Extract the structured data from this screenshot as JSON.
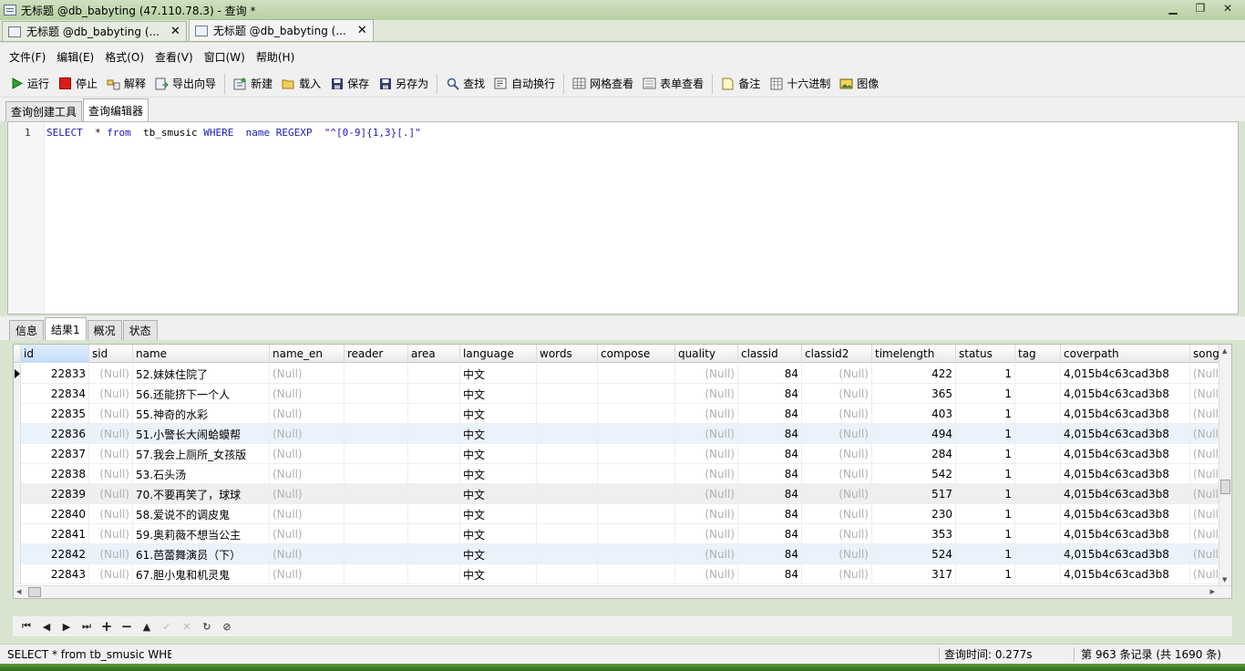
{
  "window": {
    "title": "无标题 @db_babyting (47.110.78.3) - 查询 *"
  },
  "doc_tabs": [
    {
      "label": "无标题 @db_babyting (..."
    },
    {
      "label": "无标题 @db_babyting (..."
    }
  ],
  "menu": [
    "文件(F)",
    "编辑(E)",
    "格式(O)",
    "查看(V)",
    "窗口(W)",
    "帮助(H)"
  ],
  "toolbar": {
    "run": "运行",
    "stop": "停止",
    "explain": "解释",
    "export": "导出向导",
    "new": "新建",
    "load": "载入",
    "save": "保存",
    "save_as": "另存为",
    "find": "查找",
    "wrap": "自动换行",
    "grid_view": "网格查看",
    "form_view": "表单查看",
    "memo": "备注",
    "hex": "十六进制",
    "image": "图像"
  },
  "sub_tabs": [
    "查询创建工具",
    "查询编辑器"
  ],
  "editor": {
    "line_number": "1",
    "kw_select": "SELECT",
    "star": "*",
    "kw_from": "from",
    "table": "tb_smusic",
    "kw_where": "WHERE",
    "field": "name",
    "kw_regexp": "REGEXP",
    "pattern": "\"^[0-9]{1,3}[.]\""
  },
  "result_tabs": [
    "信息",
    "结果1",
    "概况",
    "状态"
  ],
  "grid": {
    "columns": [
      "id",
      "sid",
      "name",
      "name_en",
      "reader",
      "area",
      "language",
      "words",
      "compose",
      "quality",
      "classid",
      "classid2",
      "timelength",
      "status",
      "tag",
      "coverpath",
      "songw"
    ],
    "null_text": "(Null)",
    "rows": [
      {
        "id": "22833",
        "name": "52.妹妹住院了",
        "language": "中文",
        "classid": "84",
        "timelength": "422",
        "status": "1",
        "coverpath": "4,015b4c63cad3b8"
      },
      {
        "id": "22834",
        "name": "56.还能挤下一个人",
        "language": "中文",
        "classid": "84",
        "timelength": "365",
        "status": "1",
        "coverpath": "4,015b4c63cad3b8"
      },
      {
        "id": "22835",
        "name": "55.神奇的水彩",
        "language": "中文",
        "classid": "84",
        "timelength": "403",
        "status": "1",
        "coverpath": "4,015b4c63cad3b8"
      },
      {
        "id": "22836",
        "name": "51.小警长大闹蛤蟆帮",
        "language": "中文",
        "classid": "84",
        "timelength": "494",
        "status": "1",
        "coverpath": "4,015b4c63cad3b8"
      },
      {
        "id": "22837",
        "name": "57.我会上厕所_女孩版",
        "language": "中文",
        "classid": "84",
        "timelength": "284",
        "status": "1",
        "coverpath": "4,015b4c63cad3b8"
      },
      {
        "id": "22838",
        "name": "53.石头汤",
        "language": "中文",
        "classid": "84",
        "timelength": "542",
        "status": "1",
        "coverpath": "4,015b4c63cad3b8"
      },
      {
        "id": "22839",
        "name": "70.不要再笑了，球球",
        "language": "中文",
        "classid": "84",
        "timelength": "517",
        "status": "1",
        "coverpath": "4,015b4c63cad3b8"
      },
      {
        "id": "22840",
        "name": "58.爱说不的调皮鬼",
        "language": "中文",
        "classid": "84",
        "timelength": "230",
        "status": "1",
        "coverpath": "4,015b4c63cad3b8"
      },
      {
        "id": "22841",
        "name": "59.奥莉薇不想当公主",
        "language": "中文",
        "classid": "84",
        "timelength": "353",
        "status": "1",
        "coverpath": "4,015b4c63cad3b8"
      },
      {
        "id": "22842",
        "name": "61.芭蕾舞演员（下）",
        "language": "中文",
        "classid": "84",
        "timelength": "524",
        "status": "1",
        "coverpath": "4,015b4c63cad3b8"
      },
      {
        "id": "22843",
        "name": "67.胆小鬼和机灵鬼",
        "language": "中文",
        "classid": "84",
        "timelength": "317",
        "status": "1",
        "coverpath": "4,015b4c63cad3b8"
      }
    ]
  },
  "status": {
    "sql": "SELECT  * from  tb_smusic WHE",
    "query_time": "查询时间: 0.277s",
    "records": "第 963 条记录 (共 1690 条)"
  }
}
